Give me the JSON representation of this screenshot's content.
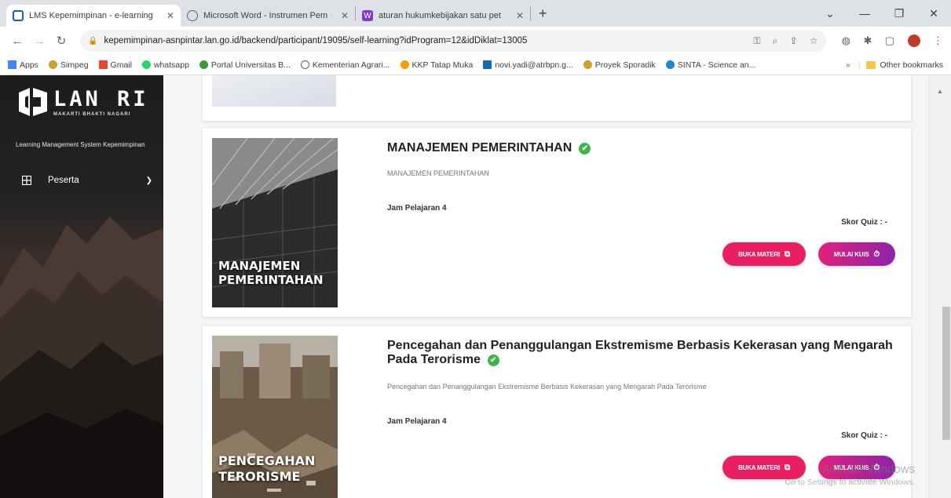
{
  "browser": {
    "tabs": [
      {
        "title": "LMS Kepemimpinan - e-learning",
        "active": true
      },
      {
        "title": "Microsoft Word - Instrumen Pem",
        "active": false
      },
      {
        "title": "aturan hukumkebijakan satu pet",
        "active": false
      }
    ],
    "url": "kepemimpinan-asnpintar.lan.go.id/backend/participant/19095/self-learning?idProgram=12&idDiklat=13005",
    "bookmarks": [
      "Apps",
      "Simpeg",
      "Gmail",
      "whatsapp",
      "Portal Universitas B...",
      "Kementerian Agrari...",
      "KKP Tatap Muka",
      "novi.yadi@atrbpn.g...",
      "Proyek Sporadik",
      "SINTA - Science an..."
    ],
    "bookmarks_more": "»",
    "other_bookmarks": "Other bookmarks"
  },
  "sidebar": {
    "logo_main": "LAN RI",
    "logo_sub": "MAKARTI BHAKTI NAGARI",
    "tagline": "Learning Management System Kepemimpinan",
    "menu_label": "Peserta"
  },
  "courses": [
    {
      "thumb_label_1": "MANAJEMEN",
      "thumb_label_2": "PEMERINTAHAN",
      "title": "MANAJEMEN PEMERINTAHAN",
      "description": "MANAJEMEN PEMERINTAHAN",
      "jam": "Jam Pelajaran 4",
      "skor": "Skor Quiz : -",
      "btn_materi": "BUKA MATERI",
      "btn_kuis": "MULAI KUIS"
    },
    {
      "thumb_label_1": "PENCEGAHAN",
      "thumb_label_2": "TERORISME",
      "title_line1": "Pencegahan dan Penanggulangan Ekstremisme Berbasis Kekerasan yang Mengarah",
      "title_line2": "Pada Terorisme",
      "description": "Pencegahan dan Penanggulangan Ekstremisme Berbasis Kekerasan yang Mengarah Pada Terorisme",
      "jam": "Jam Pelajaran 4",
      "skor": "Skor Quiz : -",
      "btn_materi": "BUKA MATERI",
      "btn_kuis": "MULAI KUIS"
    }
  ],
  "watermark": {
    "line1": "Activate Windows",
    "line2": "Go to Settings to activate Windows."
  }
}
